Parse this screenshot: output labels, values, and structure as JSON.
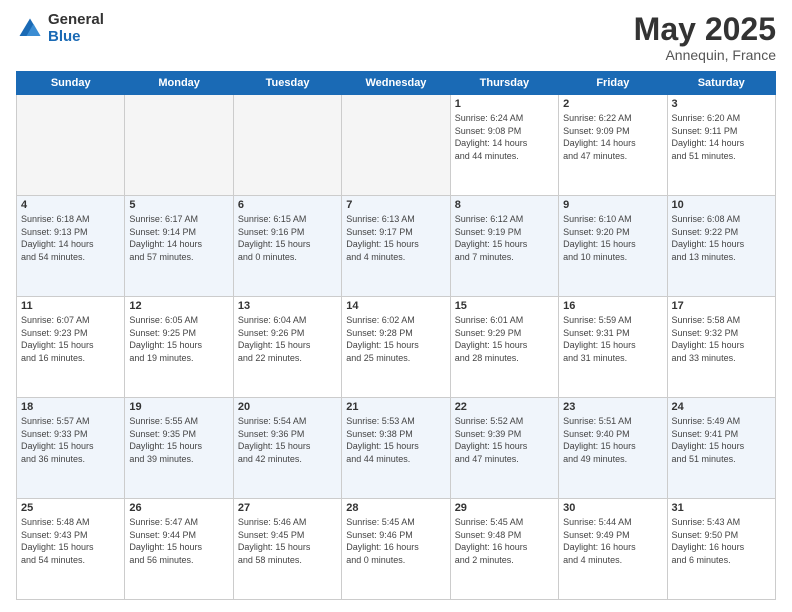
{
  "logo": {
    "general": "General",
    "blue": "Blue"
  },
  "title": {
    "month": "May 2025",
    "location": "Annequin, France"
  },
  "days_of_week": [
    "Sunday",
    "Monday",
    "Tuesday",
    "Wednesday",
    "Thursday",
    "Friday",
    "Saturday"
  ],
  "weeks": [
    [
      {
        "day": "",
        "detail": ""
      },
      {
        "day": "",
        "detail": ""
      },
      {
        "day": "",
        "detail": ""
      },
      {
        "day": "",
        "detail": ""
      },
      {
        "day": "1",
        "detail": "Sunrise: 6:24 AM\nSunset: 9:08 PM\nDaylight: 14 hours\nand 44 minutes."
      },
      {
        "day": "2",
        "detail": "Sunrise: 6:22 AM\nSunset: 9:09 PM\nDaylight: 14 hours\nand 47 minutes."
      },
      {
        "day": "3",
        "detail": "Sunrise: 6:20 AM\nSunset: 9:11 PM\nDaylight: 14 hours\nand 51 minutes."
      }
    ],
    [
      {
        "day": "4",
        "detail": "Sunrise: 6:18 AM\nSunset: 9:13 PM\nDaylight: 14 hours\nand 54 minutes."
      },
      {
        "day": "5",
        "detail": "Sunrise: 6:17 AM\nSunset: 9:14 PM\nDaylight: 14 hours\nand 57 minutes."
      },
      {
        "day": "6",
        "detail": "Sunrise: 6:15 AM\nSunset: 9:16 PM\nDaylight: 15 hours\nand 0 minutes."
      },
      {
        "day": "7",
        "detail": "Sunrise: 6:13 AM\nSunset: 9:17 PM\nDaylight: 15 hours\nand 4 minutes."
      },
      {
        "day": "8",
        "detail": "Sunrise: 6:12 AM\nSunset: 9:19 PM\nDaylight: 15 hours\nand 7 minutes."
      },
      {
        "day": "9",
        "detail": "Sunrise: 6:10 AM\nSunset: 9:20 PM\nDaylight: 15 hours\nand 10 minutes."
      },
      {
        "day": "10",
        "detail": "Sunrise: 6:08 AM\nSunset: 9:22 PM\nDaylight: 15 hours\nand 13 minutes."
      }
    ],
    [
      {
        "day": "11",
        "detail": "Sunrise: 6:07 AM\nSunset: 9:23 PM\nDaylight: 15 hours\nand 16 minutes."
      },
      {
        "day": "12",
        "detail": "Sunrise: 6:05 AM\nSunset: 9:25 PM\nDaylight: 15 hours\nand 19 minutes."
      },
      {
        "day": "13",
        "detail": "Sunrise: 6:04 AM\nSunset: 9:26 PM\nDaylight: 15 hours\nand 22 minutes."
      },
      {
        "day": "14",
        "detail": "Sunrise: 6:02 AM\nSunset: 9:28 PM\nDaylight: 15 hours\nand 25 minutes."
      },
      {
        "day": "15",
        "detail": "Sunrise: 6:01 AM\nSunset: 9:29 PM\nDaylight: 15 hours\nand 28 minutes."
      },
      {
        "day": "16",
        "detail": "Sunrise: 5:59 AM\nSunset: 9:31 PM\nDaylight: 15 hours\nand 31 minutes."
      },
      {
        "day": "17",
        "detail": "Sunrise: 5:58 AM\nSunset: 9:32 PM\nDaylight: 15 hours\nand 33 minutes."
      }
    ],
    [
      {
        "day": "18",
        "detail": "Sunrise: 5:57 AM\nSunset: 9:33 PM\nDaylight: 15 hours\nand 36 minutes."
      },
      {
        "day": "19",
        "detail": "Sunrise: 5:55 AM\nSunset: 9:35 PM\nDaylight: 15 hours\nand 39 minutes."
      },
      {
        "day": "20",
        "detail": "Sunrise: 5:54 AM\nSunset: 9:36 PM\nDaylight: 15 hours\nand 42 minutes."
      },
      {
        "day": "21",
        "detail": "Sunrise: 5:53 AM\nSunset: 9:38 PM\nDaylight: 15 hours\nand 44 minutes."
      },
      {
        "day": "22",
        "detail": "Sunrise: 5:52 AM\nSunset: 9:39 PM\nDaylight: 15 hours\nand 47 minutes."
      },
      {
        "day": "23",
        "detail": "Sunrise: 5:51 AM\nSunset: 9:40 PM\nDaylight: 15 hours\nand 49 minutes."
      },
      {
        "day": "24",
        "detail": "Sunrise: 5:49 AM\nSunset: 9:41 PM\nDaylight: 15 hours\nand 51 minutes."
      }
    ],
    [
      {
        "day": "25",
        "detail": "Sunrise: 5:48 AM\nSunset: 9:43 PM\nDaylight: 15 hours\nand 54 minutes."
      },
      {
        "day": "26",
        "detail": "Sunrise: 5:47 AM\nSunset: 9:44 PM\nDaylight: 15 hours\nand 56 minutes."
      },
      {
        "day": "27",
        "detail": "Sunrise: 5:46 AM\nSunset: 9:45 PM\nDaylight: 15 hours\nand 58 minutes."
      },
      {
        "day": "28",
        "detail": "Sunrise: 5:45 AM\nSunset: 9:46 PM\nDaylight: 16 hours\nand 0 minutes."
      },
      {
        "day": "29",
        "detail": "Sunrise: 5:45 AM\nSunset: 9:48 PM\nDaylight: 16 hours\nand 2 minutes."
      },
      {
        "day": "30",
        "detail": "Sunrise: 5:44 AM\nSunset: 9:49 PM\nDaylight: 16 hours\nand 4 minutes."
      },
      {
        "day": "31",
        "detail": "Sunrise: 5:43 AM\nSunset: 9:50 PM\nDaylight: 16 hours\nand 6 minutes."
      }
    ]
  ]
}
